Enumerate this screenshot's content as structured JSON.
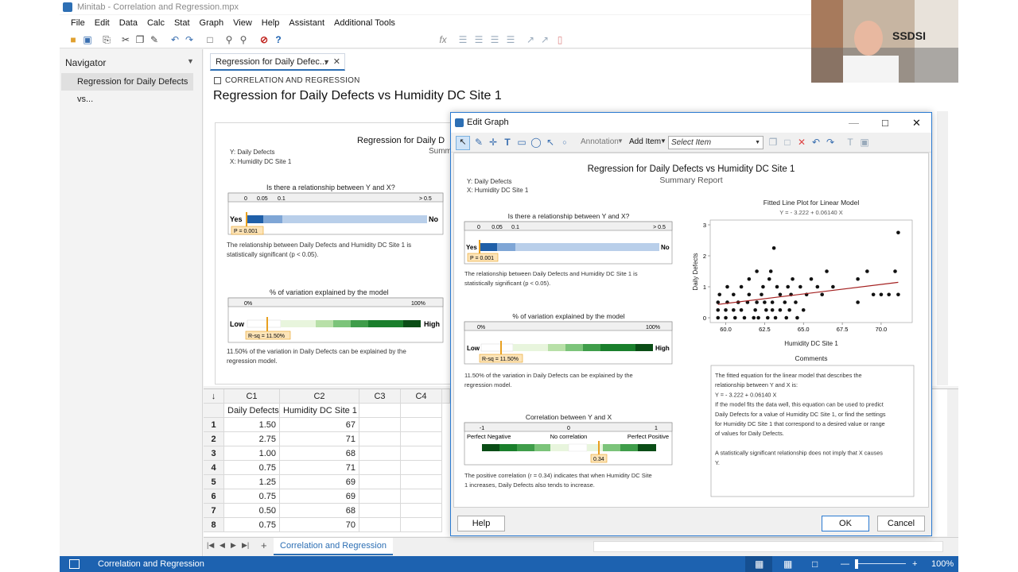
{
  "window": {
    "title": "Minitab - Correlation and Regression.mpx"
  },
  "menu": [
    "File",
    "Edit",
    "Data",
    "Calc",
    "Stat",
    "Graph",
    "View",
    "Help",
    "Assistant",
    "Additional Tools"
  ],
  "navigator": {
    "title": "Navigator",
    "item": "Regression for Daily Defects vs..."
  },
  "output_tab": {
    "label": "Regression for Daily Defec..."
  },
  "output": {
    "subtitle": "CORRELATION AND REGRESSION",
    "title": "Regression for Daily Defects vs Humidity DC Site 1",
    "report_title_partial": "Regression for Daily D",
    "report_subtitle_partial": "Summ",
    "y_label": "Y: Daily Defects",
    "x_label": "X: Humidity DC Site 1",
    "q1": "Is there a relationship between Y and X?",
    "q1_ticks": [
      "0",
      "0.05",
      "0.1",
      "> 0.5"
    ],
    "yes": "Yes",
    "no": "No",
    "p_value": "P = 0.001",
    "q1_text": "The relationship between Daily Defects and Humidity DC Site 1 is statistically significant (p < 0.05).",
    "q2": "% of variation explained by the model",
    "q2_ticks": [
      "0%",
      "100%"
    ],
    "low": "Low",
    "high": "High",
    "rsq": "R-sq = 11.50%",
    "q2_text": "11.50% of the variation in Daily Defects can be explained by the regression model."
  },
  "worksheet": {
    "col_ids": [
      "C1",
      "C2",
      "C3",
      "C4"
    ],
    "col_names": [
      "Daily Defects",
      "Humidity DC Site 1",
      "",
      ""
    ],
    "rows": [
      {
        "n": "1",
        "c1": "1.50",
        "c2": "67"
      },
      {
        "n": "2",
        "c1": "2.75",
        "c2": "71"
      },
      {
        "n": "3",
        "c1": "1.00",
        "c2": "68"
      },
      {
        "n": "4",
        "c1": "0.75",
        "c2": "71"
      },
      {
        "n": "5",
        "c1": "1.25",
        "c2": "69"
      },
      {
        "n": "6",
        "c1": "0.75",
        "c2": "69"
      },
      {
        "n": "7",
        "c1": "0.50",
        "c2": "68"
      },
      {
        "n": "8",
        "c1": "0.75",
        "c2": "70"
      }
    ]
  },
  "sheet_tab": "Correlation and Regression",
  "status": {
    "text": "Correlation and Regression",
    "zoom": "100%"
  },
  "webcam_logo": "SSDSI",
  "dialog": {
    "title": "Edit Graph",
    "annotation": "Annotation",
    "add_item": "Add Item",
    "select_item_placeholder": "Select Item",
    "help": "Help",
    "ok": "OK",
    "cancel": "Cancel",
    "report": {
      "title": "Regression for Daily Defects vs Humidity DC Site 1",
      "subtitle": "Summary Report",
      "y_label": "Y: Daily Defects",
      "x_label": "X: Humidity DC Site 1",
      "q1": "Is there a relationship between Y and X?",
      "q1_ticks": [
        "0",
        "0.05",
        "0.1",
        "> 0.5"
      ],
      "yes": "Yes",
      "no": "No",
      "p_value": "P = 0.001",
      "q1_text_1": "The relationship between Daily Defects and Humidity DC Site 1 is",
      "q1_text_2": "statistically significant (p < 0.05).",
      "q2": "% of variation explained by the model",
      "q2_ticks": [
        "0%",
        "100%"
      ],
      "low": "Low",
      "high": "High",
      "rsq": "R-sq = 11.50%",
      "q2_text_1": "11.50% of the variation in Daily Defects can be explained by the",
      "q2_text_2": "regression model.",
      "q3": "Correlation between Y and X",
      "q3_ticks": [
        "-1",
        "0",
        "1"
      ],
      "q3_labels": [
        "Perfect Negative",
        "No correlation",
        "Perfect Positive"
      ],
      "r_value": "0.34",
      "q3_text_1": "The positive correlation (r = 0.34) indicates that when Humidity DC Site",
      "q3_text_2": "1 increases, Daily Defects also tends to increase.",
      "comments_title": "Comments",
      "comments": [
        "The fitted equation for the linear model that describes the",
        "relationship between Y and X is:",
        "   Y = - 3.222 + 0.06140 X",
        "If the model fits the data well, this equation can be used to predict",
        "Daily Defects for a value of Humidity DC Site 1, or find the settings",
        "for Humidity DC Site 1 that correspond to a desired value or range",
        "of values for Daily Defects.",
        "",
        "A statistically significant relationship does not imply that X causes",
        "Y."
      ]
    }
  },
  "chart_data": {
    "type": "scatter",
    "title": "Fitted Line Plot for Linear Model",
    "subtitle": "Y = - 3.222 + 0.06140 X",
    "xlabel": "Humidity DC Site 1",
    "ylabel": "Daily Defects",
    "xlim": [
      59,
      72
    ],
    "ylim": [
      0,
      3
    ],
    "xticks": [
      60.0,
      62.5,
      65.0,
      67.5,
      70.0
    ],
    "xtick_labels": [
      "60.0",
      "62.5",
      "65.0",
      "67.5",
      "70.0"
    ],
    "yticks": [
      0,
      1,
      2,
      3
    ],
    "ytick_labels": [
      "0",
      "1",
      "2",
      "3"
    ],
    "fit": {
      "intercept": -3.222,
      "slope": 0.0614
    },
    "points": [
      [
        59.5,
        0.5
      ],
      [
        59.5,
        0.25
      ],
      [
        59.5,
        0
      ],
      [
        59.6,
        0.75
      ],
      [
        60,
        0.25
      ],
      [
        60,
        0
      ],
      [
        60.1,
        0.5
      ],
      [
        60.1,
        1
      ],
      [
        60.5,
        0.75
      ],
      [
        60.5,
        0.25
      ],
      [
        60.6,
        0
      ],
      [
        60.8,
        0.5
      ],
      [
        61,
        1
      ],
      [
        61,
        0.25
      ],
      [
        61.2,
        0
      ],
      [
        61.4,
        0.5
      ],
      [
        61.5,
        0.75
      ],
      [
        61.5,
        1.25
      ],
      [
        61.8,
        0
      ],
      [
        61.9,
        0.25
      ],
      [
        62,
        0.5
      ],
      [
        62,
        1.5
      ],
      [
        62.1,
        0
      ],
      [
        62.3,
        0.75
      ],
      [
        62.4,
        1
      ],
      [
        62.5,
        0.5
      ],
      [
        62.6,
        0.25
      ],
      [
        62.7,
        0
      ],
      [
        62.8,
        1.25
      ],
      [
        62.9,
        1.5
      ],
      [
        63,
        0.5
      ],
      [
        63,
        0.25
      ],
      [
        63.1,
        2.25
      ],
      [
        63.2,
        0
      ],
      [
        63.3,
        1
      ],
      [
        63.5,
        0.75
      ],
      [
        63.5,
        0.25
      ],
      [
        63.8,
        0.5
      ],
      [
        63.9,
        0
      ],
      [
        64,
        1
      ],
      [
        64.1,
        0.25
      ],
      [
        64.2,
        0.75
      ],
      [
        64.3,
        1.25
      ],
      [
        64.5,
        0.5
      ],
      [
        64.6,
        0
      ],
      [
        64.8,
        1
      ],
      [
        65,
        0.25
      ],
      [
        65.2,
        0.75
      ],
      [
        65.5,
        1.25
      ],
      [
        65.9,
        1
      ],
      [
        66.2,
        0.75
      ],
      [
        66.5,
        1.5
      ],
      [
        66.9,
        1
      ],
      [
        68.5,
        1.25
      ],
      [
        68.5,
        0.5
      ],
      [
        69.1,
        1.5
      ],
      [
        69.5,
        0.75
      ],
      [
        70,
        0.75
      ],
      [
        70.5,
        0.75
      ],
      [
        70.9,
        1.5
      ],
      [
        71.1,
        0.75
      ],
      [
        71.1,
        2.75
      ]
    ]
  }
}
